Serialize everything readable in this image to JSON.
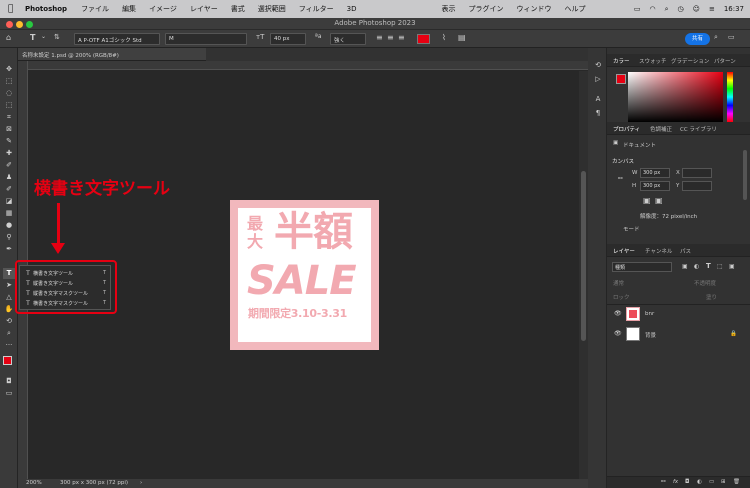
{
  "menubar": {
    "apple_icon": "apple-icon",
    "app_name": "Photoshop",
    "items": [
      "ファイル",
      "編集",
      "イメージ",
      "レイヤー",
      "書式",
      "選択範囲",
      "フィルター",
      "3D",
      "表示",
      "プラグイン",
      "ウィンドウ",
      "ヘルプ"
    ],
    "clock": "16:37"
  },
  "window": {
    "title": "Adobe Photoshop 2023"
  },
  "options_bar": {
    "font_family": "A P-OTF A1ゴシック Std",
    "font_style": "M",
    "font_size": "40 px",
    "anti_alias": "強く",
    "text_color": "#e60012",
    "share_label": "共有"
  },
  "document": {
    "tab_label": "名称未設定 1.psd @ 200% (RGB/8#)",
    "zoom": "200%",
    "size_info": "300 px x 300 px (72 ppi)"
  },
  "artwork": {
    "line1_small": "最大",
    "line1_big": "半額",
    "sale": "SALE",
    "period": "期間限定3.10-3.31",
    "border_color": "#f2b8bd",
    "text_color": "#f2a9b0"
  },
  "callout": {
    "label": "横書き文字ツール",
    "color": "#e60012"
  },
  "tool_flyout": {
    "items": [
      {
        "label": "横書き文字ツール",
        "shortcut": "T"
      },
      {
        "label": "縦書き文字ツール",
        "shortcut": "T"
      },
      {
        "label": "縦書き文字マスクツール",
        "shortcut": "T"
      },
      {
        "label": "横書き文字マスクツール",
        "shortcut": "T"
      }
    ]
  },
  "panels": {
    "color_tabs": [
      "カラー",
      "スウォッチ",
      "グラデーション",
      "パターン"
    ],
    "properties_tabs": [
      "プロパティ",
      "色調補正",
      "CC ライブラリ"
    ],
    "doc_label": "ドキュメント",
    "canvas_label": "カンバス",
    "w_label": "W",
    "w_value": "300 px",
    "h_label": "H",
    "h_value": "300 px",
    "x_label": "X",
    "y_label": "Y",
    "resolution": "解像度：72 pixel/inch",
    "mode_label": "モード",
    "layers_tabs": [
      "レイヤー",
      "チャンネル",
      "パス"
    ],
    "filter_kind": "種類",
    "blend_mode": "通常",
    "opacity_label": "不透明度",
    "lock_label": "ロック",
    "fill_label": "塗り",
    "layers": [
      {
        "name": "bnr",
        "thumb": "pink"
      },
      {
        "name": "背景",
        "thumb": "white"
      }
    ]
  },
  "colors": {
    "fg": "#e60012",
    "bg": "#1ab34c",
    "accent": "#1473e6"
  }
}
